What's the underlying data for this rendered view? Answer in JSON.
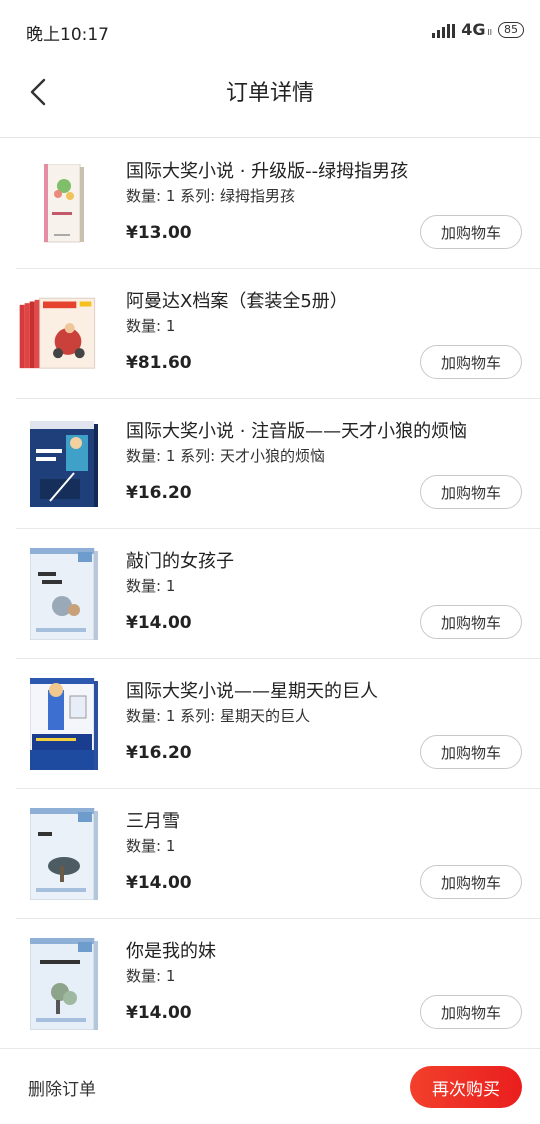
{
  "status_bar": {
    "time": "晚上10:17",
    "network": "4G",
    "network_sub": "ll",
    "battery": "85"
  },
  "header": {
    "title": "订单详情",
    "back_icon": "chevron-left-icon"
  },
  "items": [
    {
      "title": "国际大奖小说 · 升级版--绿拇指男孩",
      "meta": "数量: 1 系列: 绿拇指男孩",
      "price": "¥13.00",
      "cart_label": "加购物车"
    },
    {
      "title": "阿曼达X档案（套装全5册）",
      "meta": "数量: 1",
      "price": "¥81.60",
      "cart_label": "加购物车"
    },
    {
      "title": "国际大奖小说 · 注音版——天才小狼的烦恼",
      "meta": "数量: 1 系列: 天才小狼的烦恼",
      "price": "¥16.20",
      "cart_label": "加购物车"
    },
    {
      "title": "敲门的女孩子",
      "meta": "数量: 1",
      "price": "¥14.00",
      "cart_label": "加购物车"
    },
    {
      "title": "国际大奖小说——星期天的巨人",
      "meta": "数量: 1 系列: 星期天的巨人",
      "price": "¥16.20",
      "cart_label": "加购物车"
    },
    {
      "title": "三月雪",
      "meta": "数量: 1",
      "price": "¥14.00",
      "cart_label": "加购物车"
    },
    {
      "title": "你是我的妹",
      "meta": "数量: 1",
      "price": "¥14.00",
      "cart_label": "加购物车"
    }
  ],
  "footer": {
    "delete_label": "删除订单",
    "rebuy_label": "再次购买"
  },
  "colors": {
    "accent": "#ef2f25",
    "divider": "#e8e8e8"
  }
}
